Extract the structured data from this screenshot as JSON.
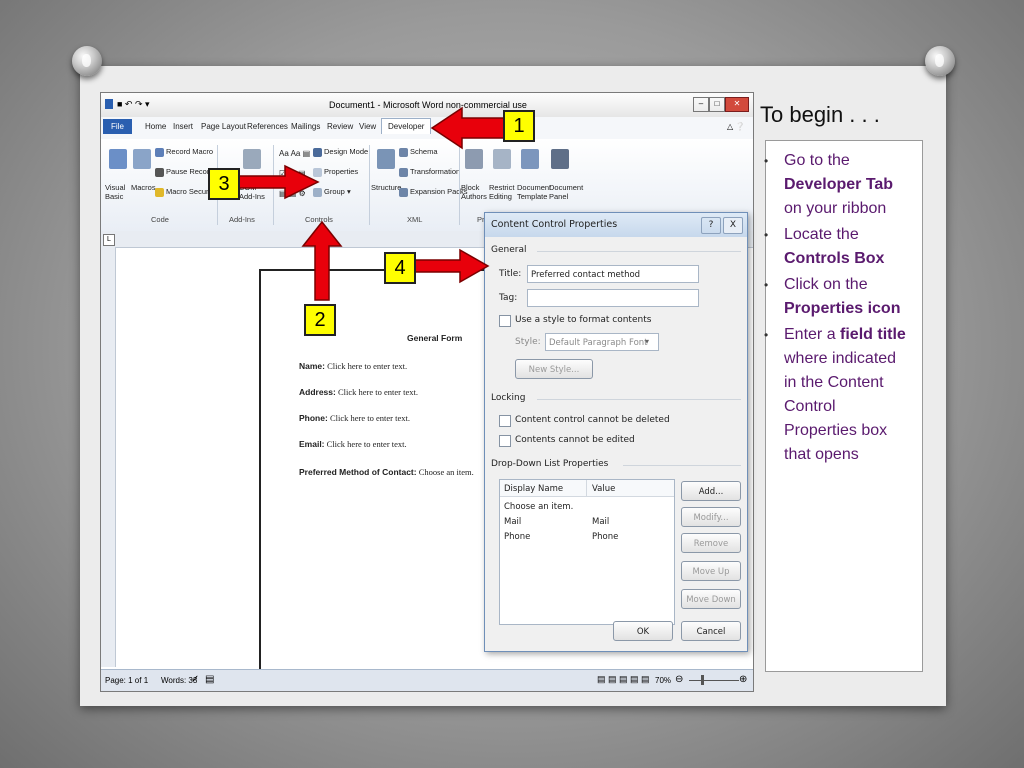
{
  "window": {
    "title": "Document1 - Microsoft Word non-commercial use"
  },
  "ribbon_tabs": [
    "File",
    "Home",
    "Insert",
    "Page Layout",
    "References",
    "Mailings",
    "Review",
    "View",
    "Developer"
  ],
  "ribbon": {
    "code": {
      "visual_basic": "Visual Basic",
      "macros": "Macros",
      "record_macro": "Record Macro",
      "pause_recording": "Pause Recording",
      "macro_security": "Macro Security",
      "group": "Code"
    },
    "addins": {
      "com": "COM Add-Ins",
      "group": "Add-Ins"
    },
    "controls": {
      "design_mode": "Design Mode",
      "properties": "Properties",
      "group_btn": "Group",
      "group": "Controls"
    },
    "xml": {
      "structure": "Structure",
      "schema": "Schema",
      "transformation": "Transformation",
      "expansion_packs": "Expansion Packs",
      "group": "XML"
    },
    "protect": {
      "block_authors": "Block Authors",
      "restrict_editing": "Restrict Editing",
      "document_template": "Document Template",
      "document_panel": "Document Panel",
      "group": "Pr"
    }
  },
  "document": {
    "heading": "General Form",
    "fields": [
      {
        "label": "Name:",
        "value": "Click here to enter text."
      },
      {
        "label": "Address:",
        "value": "Click here to enter text."
      },
      {
        "label": "Phone:",
        "value": "Click here to enter text."
      },
      {
        "label": "Email:",
        "value": "Click here to enter text."
      },
      {
        "label": "Preferred Method of Contact:",
        "value": "Choose an item."
      }
    ]
  },
  "statusbar": {
    "page": "Page: 1 of 1",
    "words": "Words: 33",
    "zoom": "70%"
  },
  "dialog": {
    "title": "Content Control Properties",
    "help": "?",
    "close": "X",
    "general": "General",
    "title_label": "Title:",
    "title_value": "Preferred contact method",
    "tag_label": "Tag:",
    "tag_value": "",
    "use_style": "Use a style to format contents",
    "style_label": "Style:",
    "style_value": "Default Paragraph Font",
    "new_style": "New Style...",
    "locking": "Locking",
    "lock_delete": "Content control cannot be deleted",
    "lock_edit": "Contents cannot be edited",
    "ddl": "Drop-Down List Properties",
    "col_display": "Display Name",
    "col_value": "Value",
    "rows": [
      {
        "display": "Choose an item.",
        "value": ""
      },
      {
        "display": "Mail",
        "value": "Mail"
      },
      {
        "display": "Phone",
        "value": "Phone"
      }
    ],
    "buttons": {
      "add": "Add...",
      "modify": "Modify...",
      "remove": "Remove",
      "move_up": "Move Up",
      "move_down": "Move Down",
      "ok": "OK",
      "cancel": "Cancel"
    }
  },
  "callouts": [
    "1",
    "2",
    "3",
    "4"
  ],
  "panel": {
    "heading": "To begin . . .",
    "steps": [
      {
        "a": "Go to the ",
        "b": "Developer Tab",
        "c": " on your ribbon"
      },
      {
        "a": "Locate the ",
        "b": "Controls Box",
        "c": ""
      },
      {
        "a": "Click on the ",
        "b": "Properties icon",
        "c": ""
      },
      {
        "a": "Enter a ",
        "b": "field title",
        "c": " where indicated in the Content Control Properties box that opens"
      }
    ]
  },
  "colors": {
    "arrow": "#e8000b",
    "callout": "#ffff00",
    "panel_text": "#5a1a6e",
    "file_tab": "#2a5fb0"
  }
}
